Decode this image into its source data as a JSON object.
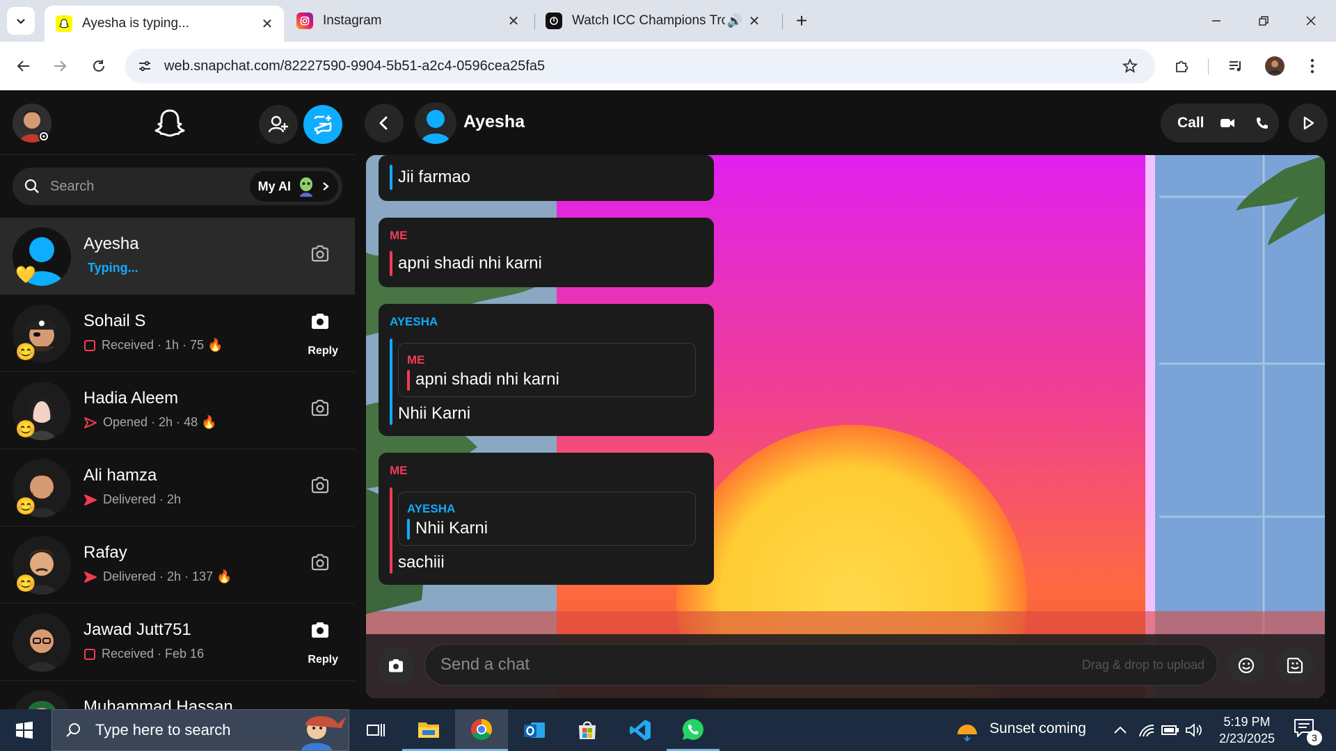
{
  "browser": {
    "tabs": [
      {
        "title": "Ayesha is typing...",
        "active": true,
        "favicon": "snapchat-icon"
      },
      {
        "title": "Instagram",
        "active": false,
        "favicon": "instagram-icon"
      },
      {
        "title": "Watch ICC Champions Trop",
        "active": false,
        "favicon": "hotstar-icon",
        "audio": true
      }
    ],
    "new_tab_label": "+",
    "url": "web.snapchat.com/82227590-9904-5b51-a2c4-0596cea25fa5"
  },
  "sidebar": {
    "search_placeholder": "Search",
    "myai_label": "My AI",
    "chats": [
      {
        "name": "Ayesha",
        "status": "Typing...",
        "typing": true,
        "emoji": "💛",
        "camera": "outline"
      },
      {
        "name": "Sohail S",
        "status": "Received · 1h · 75 🔥",
        "status_icon": "received-square-icon",
        "emoji": "😊",
        "camera": "filled",
        "reply": "Reply"
      },
      {
        "name": "Hadia Aleem",
        "status": "Opened · 2h · 48 🔥",
        "status_icon": "opened-arrow-icon",
        "emoji": "😊",
        "camera": "outline"
      },
      {
        "name": "Ali hamza",
        "status": "Delivered · 2h",
        "status_icon": "delivered-arrow-icon",
        "emoji": "😊",
        "camera": "outline"
      },
      {
        "name": "Rafay",
        "status": "Delivered · 2h · 137 🔥",
        "status_icon": "delivered-arrow-icon",
        "emoji": "😊",
        "camera": "outline"
      },
      {
        "name": "Jawad Jutt751",
        "status": "Received · Feb 16",
        "status_icon": "received-square-icon",
        "emoji": "😊",
        "camera": "filled",
        "reply": "Reply"
      },
      {
        "name": "Muhammad Hassan",
        "status": "",
        "camera": "outline"
      }
    ]
  },
  "chat": {
    "contact_name": "Ayesha",
    "call_label": "Call",
    "messages": [
      {
        "sender": "",
        "text": "Jii farmao",
        "line": "her"
      },
      {
        "sender": "ME",
        "text": "apni shadi nhi karni",
        "line": "me"
      },
      {
        "sender": "AYESHA",
        "quote_sender": "ME",
        "quote_text": "apni shadi nhi karni",
        "text": "Nhii Karni",
        "line": "her"
      },
      {
        "sender": "ME",
        "quote_sender": "AYESHA",
        "quote_text": "Nhii Karni",
        "text": "sachiii",
        "line": "me"
      }
    ],
    "composer_placeholder": "Send a chat",
    "drag_drop_hint": "Drag & drop to upload"
  },
  "taskbar": {
    "search_placeholder": "Type here to search",
    "weather_text": "Sunset coming",
    "time": "5:19 PM",
    "date": "2/23/2025",
    "notification_count": "3"
  },
  "colors": {
    "snap_blue": "#0fadff",
    "me_red": "#f23c57",
    "app_bg": "#121212"
  }
}
